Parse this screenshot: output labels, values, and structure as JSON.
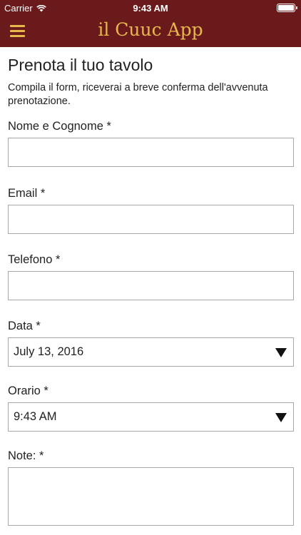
{
  "status_bar": {
    "carrier": "Carrier",
    "time": "9:43 AM"
  },
  "header": {
    "title": "il Cuuc App",
    "menu_icon": "hamburger-menu-icon"
  },
  "form": {
    "title": "Prenota il tuo tavolo",
    "intro": "Compila il form, riceverai a breve conferma dell'avvenuta prenotazione.",
    "name_label": "Nome e Cognome *",
    "name_value": "",
    "email_label": "Email *",
    "email_value": "",
    "phone_label": "Telefono *",
    "phone_value": "",
    "date_label": "Data *",
    "date_value": "July 13, 2016",
    "time_label": "Orario *",
    "time_value": "9:43 AM",
    "notes_label": "Note: *",
    "notes_value": ""
  },
  "colors": {
    "header_bg": "#6b1a1c",
    "accent": "#e7b84e"
  }
}
